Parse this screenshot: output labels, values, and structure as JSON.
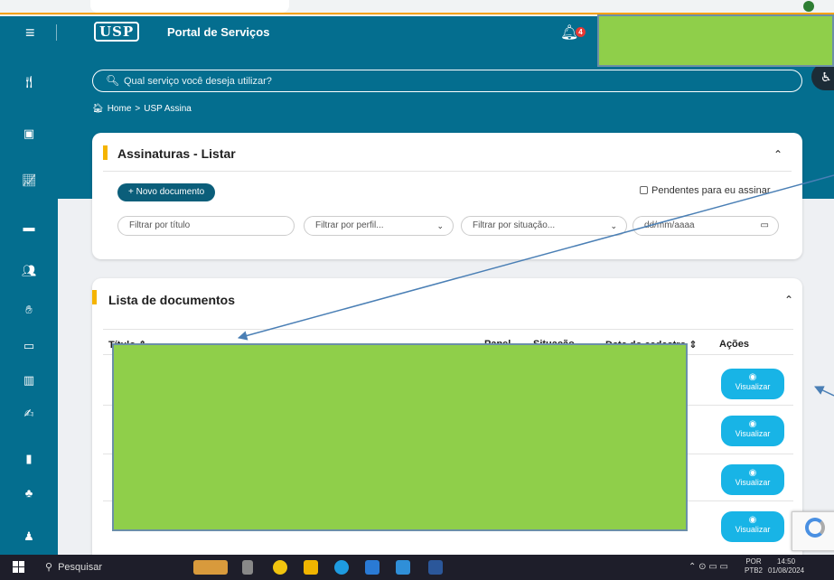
{
  "header": {
    "menu_icon": "hamburger-icon",
    "logo_text": "USP",
    "title": "Portal de Serviços",
    "notif_icon": "bell-icon",
    "notif_count": "4"
  },
  "search": {
    "placeholder": "Qual serviço você deseja utilizar?"
  },
  "breadcrumb": {
    "home": "Home",
    "sep": ">",
    "current": "USP Assina"
  },
  "signatures_card": {
    "title": "Assinaturas - Listar",
    "new_button": "+ Novo documento",
    "pending_label": "Pendentes para eu assinar",
    "filter_title_placeholder": "Filtrar por título",
    "filter_profile": "Filtrar por perfil...",
    "filter_status": "Filtrar por situação...",
    "filter_date": "dd/mm/aaaa"
  },
  "documents_card": {
    "title": "Lista de documentos",
    "columns": [
      "Título",
      "Papel",
      "Situação",
      "Data do cadastro",
      "Ações"
    ],
    "view_label": "Visualizar"
  },
  "taskbar": {
    "search_label": "Pesquisar",
    "lang_top": "POR",
    "lang_bottom": "PTB2",
    "time": "14:50",
    "date": "01/08/2024"
  },
  "colors": {
    "teal": "#046e8f",
    "accent_yellow": "#f5b400",
    "view_button": "#18b4e6",
    "redaction": "#8fcf4a"
  }
}
